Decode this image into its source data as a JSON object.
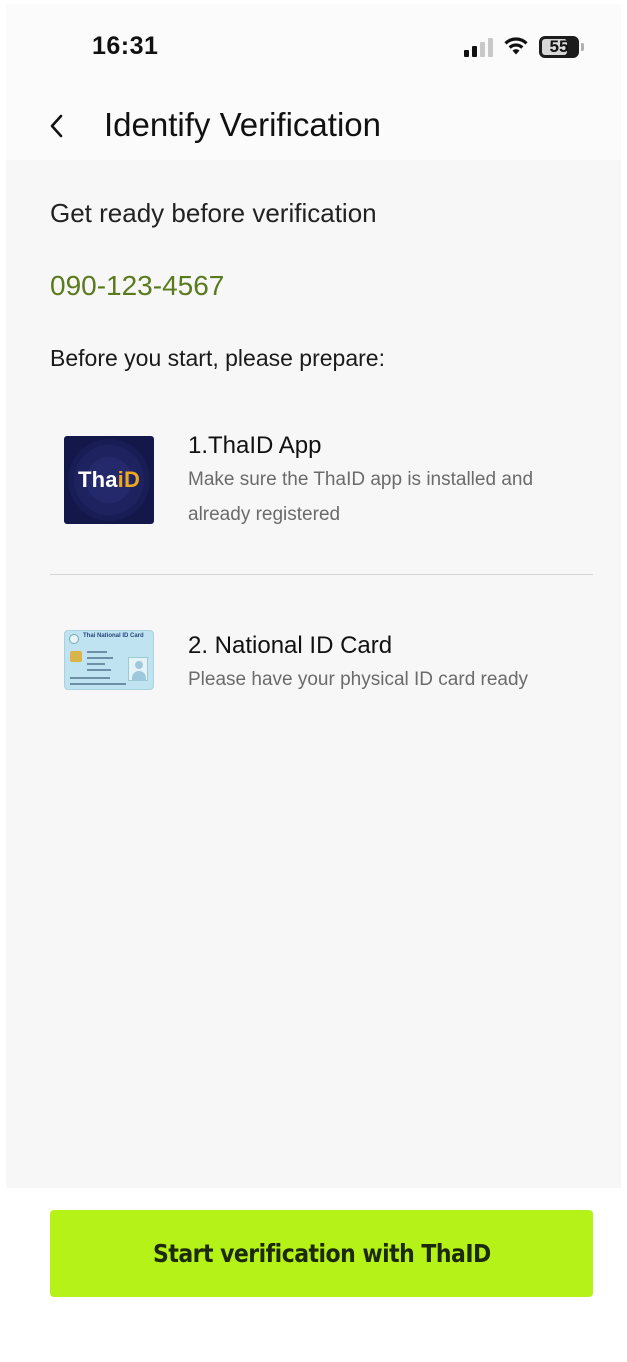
{
  "status_bar": {
    "time": "16:31",
    "battery_percent": "55"
  },
  "header": {
    "back_icon": "chevron-left-icon",
    "title": "Identify Verification"
  },
  "main": {
    "heading": "Get ready before verification",
    "phone_number": "090-123-4567",
    "prepare_label": "Before you start, please prepare:",
    "items": [
      {
        "icon": "thaid-app-logo",
        "logo_text_a": "Tha",
        "logo_text_b": "iD",
        "title": "1.ThaID App",
        "description": "Make sure the ThaID app is installed and already registered"
      },
      {
        "icon": "national-id-card-image",
        "card_caption": "Thai National ID Card",
        "title": "2. National ID Card",
        "description": "Please have your physical ID card ready"
      }
    ]
  },
  "footer": {
    "cta_label": "Start verification with ThaID"
  },
  "colors": {
    "accent": "#b5f217",
    "phone_number": "#5a7a1e",
    "background": "#f7f7f7"
  }
}
